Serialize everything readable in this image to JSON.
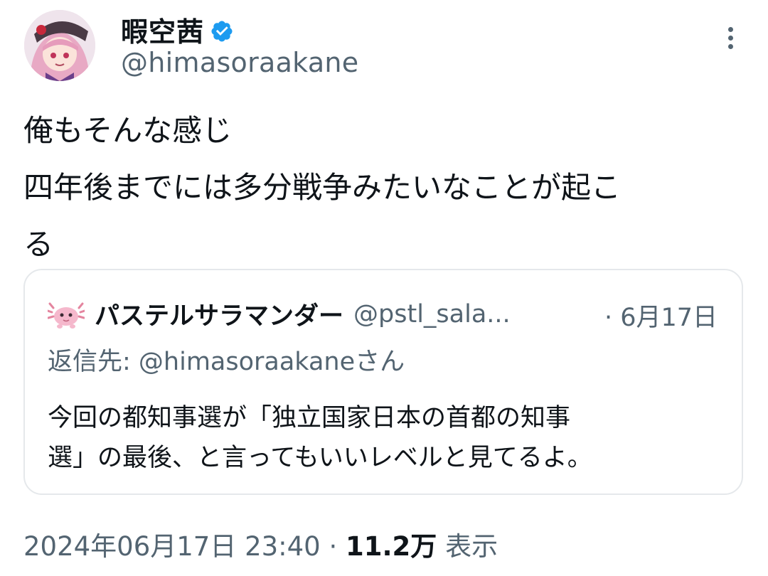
{
  "author": {
    "display_name": "暇空茜",
    "handle": "@himasoraakane",
    "verified_icon": "verified-badge-icon",
    "verified_color": "#1d9bf0"
  },
  "tweet": {
    "text": "俺もそんな感じ\n四年後までには多分戦争みたいなことが起こ\nる"
  },
  "quote": {
    "display_name": "パステルサラマンダー",
    "handle": "@pstl_sala...",
    "date": "· 6月17日",
    "reply_to": "返信先: @himasoraakaneさん",
    "text": "今回の都知事選が「独立国家日本の首都の知事\n選」の最後、と言ってもいいレベルと見てるよ。"
  },
  "meta": {
    "timestamp": "2024年06月17日 23:40",
    "separator": "·",
    "views_count": "11.2万",
    "views_label": "表示"
  },
  "icons": {
    "more": "more-vertical-icon"
  },
  "colors": {
    "text_primary": "#0f1419",
    "text_secondary": "#536471",
    "border": "#e5e8eb"
  }
}
